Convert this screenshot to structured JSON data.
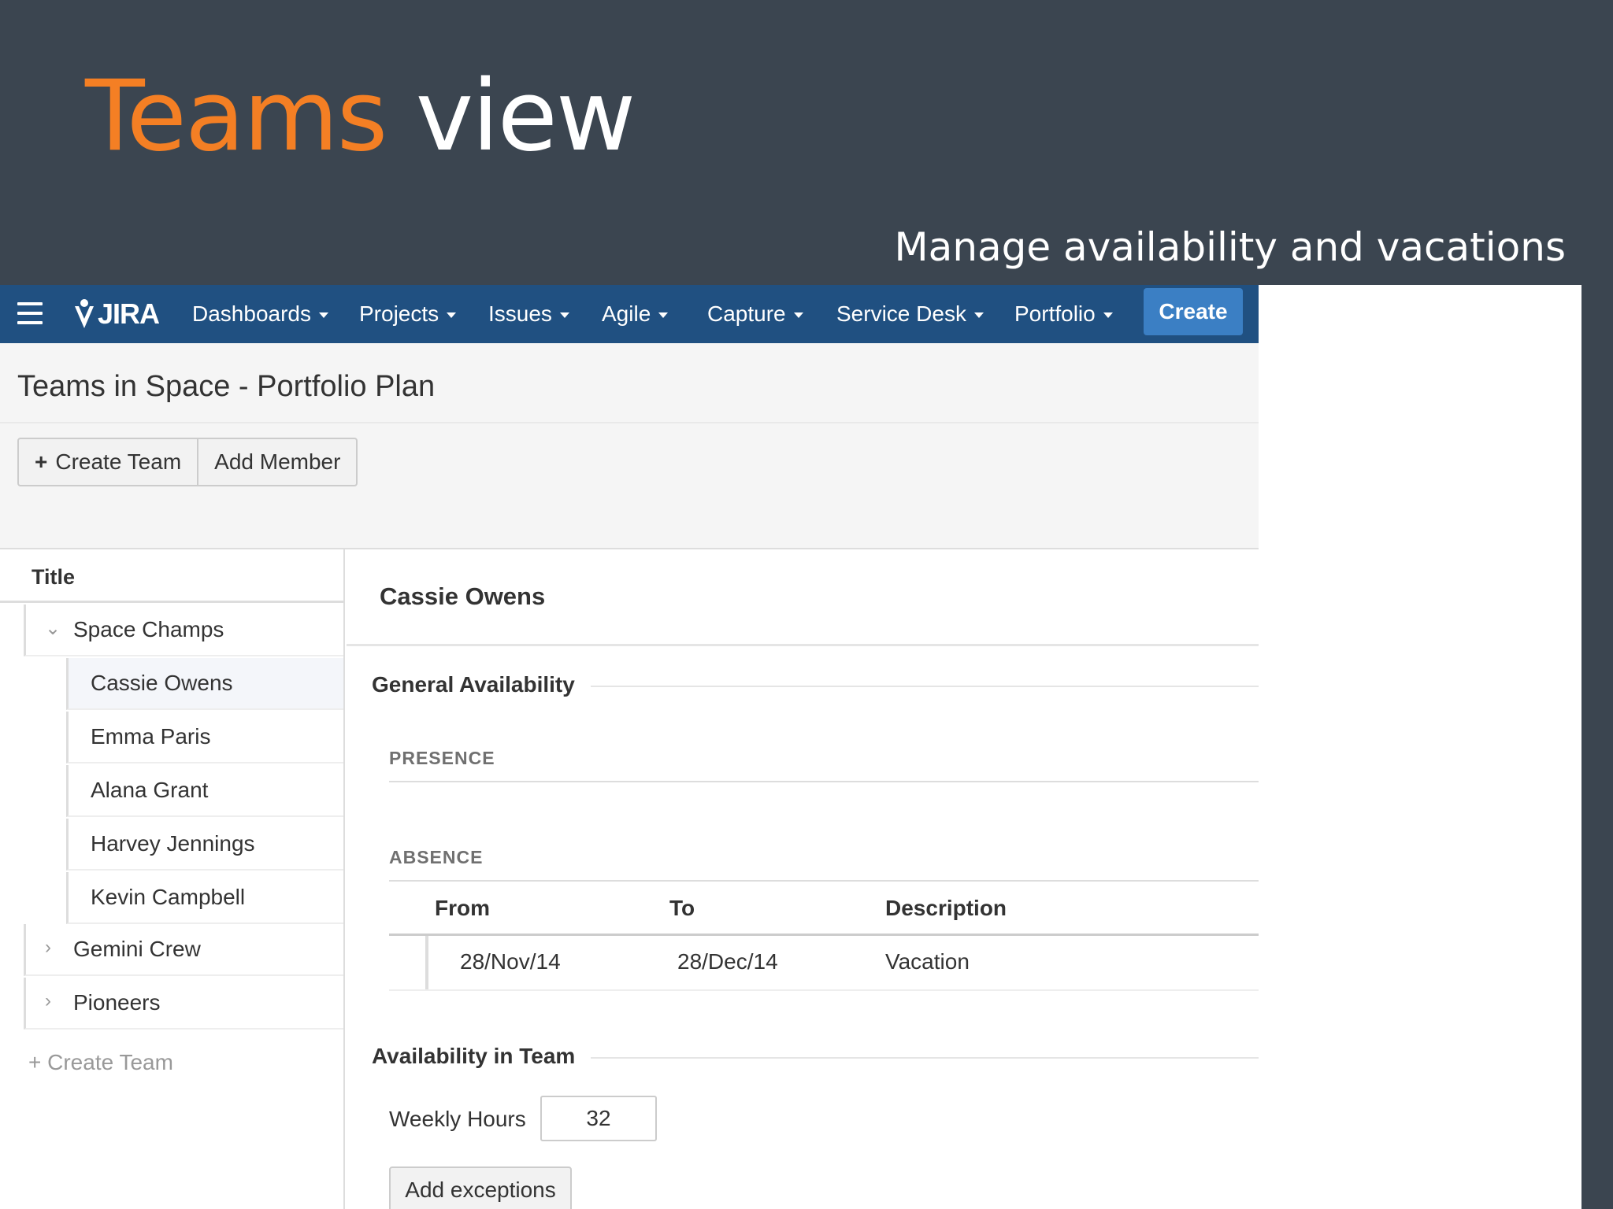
{
  "slide": {
    "title_part1": "Teams",
    "title_part2": "view",
    "subtitle": "Manage availability and vacations"
  },
  "navbar": {
    "logo_text": "JIRA",
    "items": [
      {
        "label": "Dashboards"
      },
      {
        "label": "Projects"
      },
      {
        "label": "Issues"
      },
      {
        "label": "Agile"
      },
      {
        "label": "Capture"
      },
      {
        "label": "Service Desk"
      },
      {
        "label": "Portfolio"
      }
    ],
    "create_label": "Create"
  },
  "page": {
    "title": "Teams in Space - Portfolio Plan",
    "create_team_label": "Create Team",
    "add_member_label": "Add Member"
  },
  "tree": {
    "header": "Title",
    "teams": [
      {
        "name": "Space Champs",
        "expanded": true,
        "members": [
          "Cassie Owens",
          "Emma Paris",
          "Alana Grant",
          "Harvey Jennings",
          "Kevin Campbell"
        ]
      },
      {
        "name": "Gemini Crew",
        "expanded": false
      },
      {
        "name": "Pioneers",
        "expanded": false
      }
    ],
    "selected_member": "Cassie Owens",
    "create_team_link": "+ Create Team"
  },
  "details": {
    "person_name": "Cassie Owens",
    "general_availability_title": "General Availability",
    "presence_label": "PRESENCE",
    "absence_label": "ABSENCE",
    "absence_columns": [
      "From",
      "To",
      "Description"
    ],
    "absence_rows": [
      {
        "from": "28/Nov/14",
        "to": "28/Dec/14",
        "description": "Vacation"
      }
    ],
    "availability_in_team_title": "Availability in Team",
    "weekly_hours_label": "Weekly Hours",
    "weekly_hours_value": "32",
    "add_exceptions_label": "Add exceptions"
  },
  "colors": {
    "slide_bg": "#3b4550",
    "title_accent": "#f47f24",
    "navbar_bg": "#205081",
    "create_button": "#3b7fc4"
  }
}
